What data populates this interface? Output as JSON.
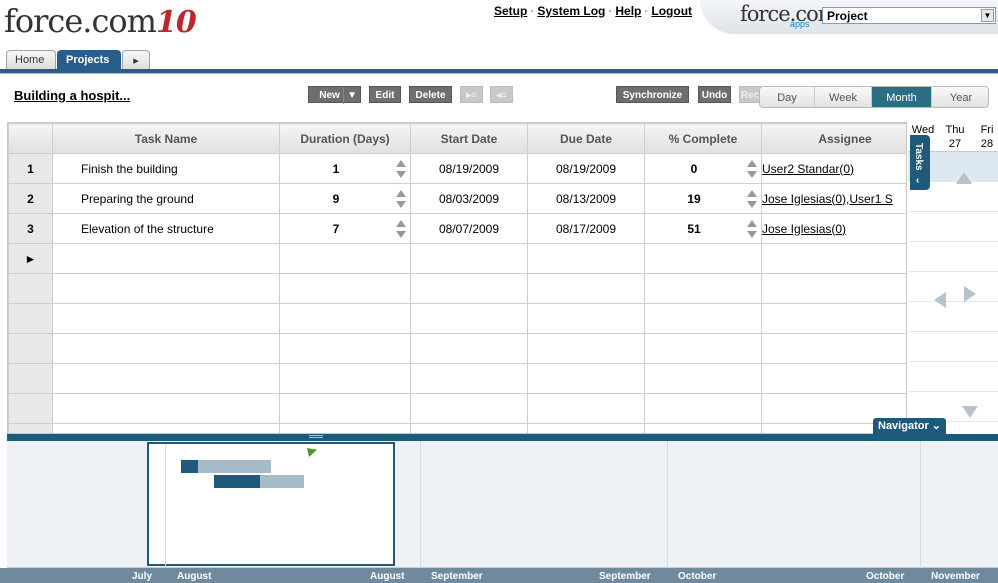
{
  "header": {
    "logo_text": "force.com",
    "logo_ten": "10",
    "links": [
      "Setup",
      "System Log",
      "Help",
      "Logout"
    ],
    "apps_logo": "force.com",
    "apps_sub": "apps",
    "app_select": "Project",
    "tabs": [
      "Home",
      "Projects"
    ]
  },
  "toolbar": {
    "project_name": "Building a hospit...",
    "new_label": "New",
    "edit_label": "Edit",
    "delete_label": "Delete",
    "sync_label": "Synchronize",
    "undo_label": "Undo",
    "redo_label": "Rec",
    "view_options": [
      "Day",
      "Week",
      "Month",
      "Year"
    ],
    "active_view": "Month"
  },
  "grid": {
    "columns": [
      "Task Name",
      "Duration (Days)",
      "Start Date",
      "Due Date",
      "% Complete",
      "Assignee"
    ],
    "rows": [
      {
        "num": "1",
        "name": "Finish the building",
        "duration": "1",
        "start": "08/19/2009",
        "due": "08/19/2009",
        "complete": "0",
        "assignee": "User2 Standar(0)"
      },
      {
        "num": "2",
        "name": "Preparing the ground",
        "duration": "9",
        "start": "08/03/2009",
        "due": "08/13/2009",
        "complete": "19",
        "assignee": "Jose Iglesias(0),User1 S"
      },
      {
        "num": "3",
        "name": "Elevation of the structure",
        "duration": "7",
        "start": "08/07/2009",
        "due": "08/17/2009",
        "complete": "51",
        "assignee": "Jose Iglesias(0)"
      }
    ],
    "new_row_marker": "►"
  },
  "gantt": {
    "days": [
      {
        "dow": "Wed",
        "num": ""
      },
      {
        "dow": "Thu",
        "num": "27"
      },
      {
        "dow": "Fri",
        "num": "28"
      }
    ],
    "tasks_tab": "Tasks",
    "navigator_label": "Navigator"
  },
  "overview": {
    "months": [
      "July",
      "August",
      "August",
      "September",
      "September",
      "October",
      "October",
      "November"
    ]
  }
}
